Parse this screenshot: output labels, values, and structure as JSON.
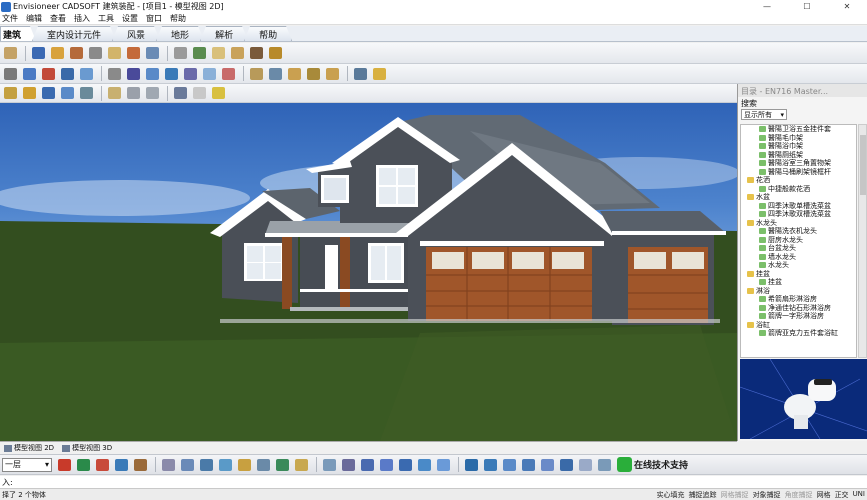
{
  "window": {
    "title": "Envisioneer CADSOFT 建筑装配 - [项目1 - 模型视图 2D]",
    "buttons": [
      "—",
      "☐",
      "✕"
    ]
  },
  "menu": [
    "文件",
    "编辑",
    "查看",
    "插入",
    "工具",
    "设置",
    "窗口",
    "帮助"
  ],
  "ribbon_tabs": [
    {
      "label": "建筑",
      "active": true
    },
    {
      "label": "室内设计元件",
      "active": false
    },
    {
      "label": "风景",
      "active": false
    },
    {
      "label": "地形",
      "active": false
    },
    {
      "label": "解析",
      "active": false
    },
    {
      "label": "帮助",
      "active": false
    }
  ],
  "toolbar_colors": {
    "row1": [
      "#c4a266",
      "#3b69b3",
      "#d8a23d",
      "#b56a3a",
      "#8a8a8a",
      "#d2b46a",
      "#c46a3a",
      "#6a8bb5",
      "#9a9a9a",
      "#5a8c4f",
      "#d9c07a",
      "#c9a25a",
      "#7a5a3a",
      "#b88a2a"
    ],
    "row2": [
      "#7a7a7a",
      "#4a7ac4",
      "#c24a3a",
      "#3a6aa8",
      "#6a9ad0",
      "#8a8a8a",
      "#4a4a9a",
      "#5a8ac8",
      "#3a7ab8",
      "#6a6aaa",
      "#8ab0d8",
      "#c86a6a",
      "#b89a5a",
      "#6a8aa8",
      "#caa050",
      "#a88a3a",
      "#c9a050",
      "#5a7a9a",
      "#d8b040"
    ],
    "row3": [
      "#c4a040",
      "#d0a030",
      "#3a6ab0",
      "#5a8ac8",
      "#6a8a9a",
      "#c8b070",
      "#9aa0aa",
      "#a0a8b2",
      "#6a7a9a",
      "#c8c8c8",
      "#d8c040"
    ],
    "row4": [
      "#c83a2a",
      "#2a8a4a",
      "#c84a3a",
      "#3a7ab8",
      "#9a6a3a",
      "#8a8aaa",
      "#6a8ab8",
      "#4a7aa8",
      "#5a9ac8",
      "#c8a040",
      "#6a8aa8",
      "#3a8a5a",
      "#c8a850",
      "#7a9aba",
      "#6a6a9a",
      "#4a6ab0",
      "#5a7ac8",
      "#3a6ab0",
      "#4a8ac8",
      "#6a9ad8",
      "#2a6aa8",
      "#3a7ab8",
      "#5a8ac8",
      "#4a7ab8",
      "#6a8ac8",
      "#3a6aa8",
      "#9aaac8",
      "#7a9ab8"
    ]
  },
  "right_panel": {
    "header": "目录 - EN716 Master...",
    "search_label": "搜索",
    "filter_value": "显示所有",
    "tree": [
      {
        "type": "item",
        "label": "醫陽卫浴五金挂件套"
      },
      {
        "type": "item",
        "label": "醫陽毛巾架"
      },
      {
        "type": "item",
        "label": "醫陽浴巾架"
      },
      {
        "type": "item",
        "label": "醫陽厕纸架"
      },
      {
        "type": "item",
        "label": "醫陽浴室三角置物架"
      },
      {
        "type": "item",
        "label": "醫陽马桶刷架镜框杆"
      },
      {
        "type": "cat",
        "label": "花洒"
      },
      {
        "type": "item",
        "label": "中捷般款花洒"
      },
      {
        "type": "cat",
        "label": "水盆"
      },
      {
        "type": "item",
        "label": "四季沐歌单槽洗菜盆"
      },
      {
        "type": "item",
        "label": "四季沐歌双槽洗菜盆"
      },
      {
        "type": "cat",
        "label": "水龙头"
      },
      {
        "type": "item",
        "label": "醫陽洗衣机龙头"
      },
      {
        "type": "item",
        "label": "厨房水龙头"
      },
      {
        "type": "item",
        "label": "台盆龙头"
      },
      {
        "type": "item",
        "label": "墙水龙头"
      },
      {
        "type": "item",
        "label": "水龙头"
      },
      {
        "type": "cat",
        "label": "挂盆"
      },
      {
        "type": "item",
        "label": "挂盆"
      },
      {
        "type": "cat",
        "label": "淋浴"
      },
      {
        "type": "item",
        "label": "希箭扇形淋浴房"
      },
      {
        "type": "item",
        "label": "净通佳钻石形淋浴房"
      },
      {
        "type": "item",
        "label": "箭牌一字形淋浴房"
      },
      {
        "type": "cat",
        "label": "浴缸"
      },
      {
        "type": "item",
        "label": "箭牌亚克力五件套浴缸"
      }
    ]
  },
  "view_tabs": [
    {
      "label": "模型视图 2D"
    },
    {
      "label": "模型视图 3D"
    }
  ],
  "bottom_toolbar": {
    "layer_value": "一层",
    "online_support": "在线技术支持"
  },
  "command_line": "入:",
  "status": {
    "left": "择了 2 个物体",
    "right": [
      {
        "label": "实心填充",
        "dim": false
      },
      {
        "label": "捕捉追踪",
        "dim": false
      },
      {
        "label": "网格捕捉",
        "dim": true
      },
      {
        "label": "对象捕捉",
        "dim": false
      },
      {
        "label": "角度捕捉",
        "dim": true
      },
      {
        "label": "网格",
        "dim": false
      },
      {
        "label": "正交",
        "dim": false
      },
      {
        "label": "UNI",
        "dim": false
      }
    ]
  }
}
